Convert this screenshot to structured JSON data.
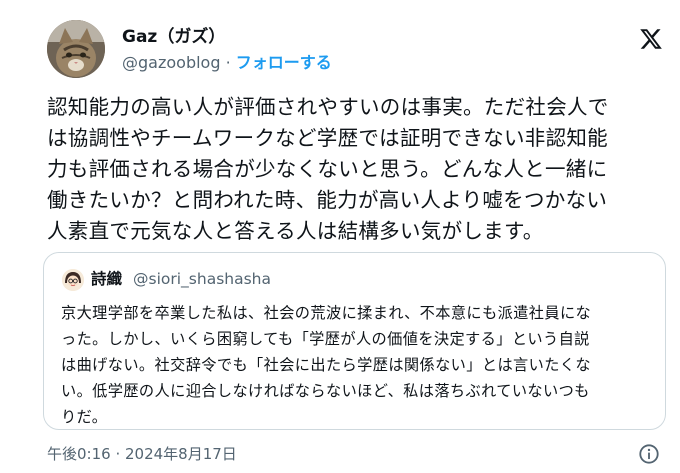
{
  "author": {
    "name": "Gaz（ガズ）",
    "handle": "@gazooblog",
    "separator": "·",
    "follow_label": "フォローする"
  },
  "icons": {
    "logo": "x-logo-icon",
    "info": "info-circle-icon",
    "avatar": "cat-avatar"
  },
  "colors": {
    "accent": "#1d9bf0",
    "text": "#0f1419",
    "muted": "#536471",
    "border": "#cfd9de"
  },
  "post": {
    "lines": [
      "認知能力の高い人が評価されやすいのは事実。ただ社会人で",
      "は協調性やチームワークなど学歴では証明できない非認知能",
      "力も評価される場合が少なくないと思う。どんな人と一緒に",
      "働きたいか？と問われた時、能力が高い人より嘘をつかない",
      "人素直で元気な人と答える人は結構多い気がします。"
    ]
  },
  "quoted": {
    "name": "詩織",
    "handle": "@siori_shashasha",
    "lines": [
      "京大理学部を卒業した私は、社会の荒波に揉まれ、不本意にも派遣社員にな",
      "った。しかし、いくら困窮しても「学歴が人の価値を決定する」という自説",
      "は曲げない。社交辞令でも「社会に出たら学歴は関係ない」とは言いたくな",
      "い。低学歴の人に迎合しなければならないほど、私は落ちぶれていないつも",
      "りだ。"
    ]
  },
  "meta": {
    "timestamp": "午後0:16 · 2024年8月17日"
  }
}
